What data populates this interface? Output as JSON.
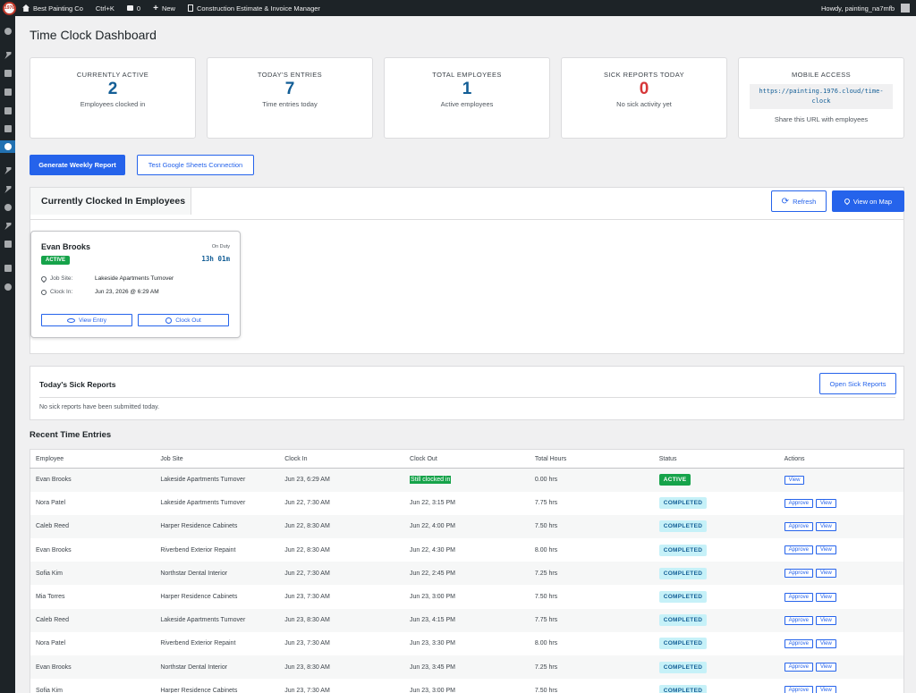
{
  "adminbar": {
    "logo_text": "1976",
    "site_name": "Best Painting Co",
    "shortcut": "Ctrl+K",
    "comments_count": "0",
    "new_label": "New",
    "plugin_name": "Construction Estimate & Invoice Manager",
    "howdy": "Howdy, painting_na7mfb"
  },
  "page": {
    "title": "Time Clock Dashboard"
  },
  "stats": {
    "active": {
      "label": "CURRENTLY ACTIVE",
      "value": "2",
      "sub": "Employees clocked in"
    },
    "entries": {
      "label": "TODAY'S ENTRIES",
      "value": "7",
      "sub": "Time entries today"
    },
    "employees": {
      "label": "TOTAL EMPLOYEES",
      "value": "1",
      "sub": "Active employees"
    },
    "sick": {
      "label": "SICK REPORTS TODAY",
      "value": "0",
      "sub": "No sick activity yet"
    },
    "mobile": {
      "label": "MOBILE ACCESS",
      "url": "https://painting.1976.cloud/time-clock",
      "note": "Share this URL with employees"
    }
  },
  "actions": {
    "weekly_report": "Generate Weekly Report",
    "test_sheets": "Test Google Sheets Connection"
  },
  "clocked_in": {
    "title": "Currently Clocked In Employees",
    "refresh": "Refresh",
    "view_map": "View on Map",
    "card": {
      "name": "Evan Brooks",
      "badge": "ACTIVE",
      "duty": "On Duty",
      "elapsed": "13h 01m",
      "job_site_label": "Job Site:",
      "job_site": "Lakeside Apartments Turnover",
      "clock_in_label": "Clock In:",
      "clock_in": "Jun 23, 2026 @ 6:29 AM",
      "view_entry": "View Entry",
      "clock_out": "Clock Out"
    }
  },
  "sick_reports": {
    "title": "Today's Sick Reports",
    "open_button": "Open Sick Reports",
    "empty": "No sick reports have been submitted today."
  },
  "recent": {
    "title": "Recent Time Entries",
    "columns": [
      "Employee",
      "Job Site",
      "Clock In",
      "Clock Out",
      "Total Hours",
      "Status",
      "Actions"
    ],
    "approve_label": "Approve",
    "view_label": "View",
    "rows": [
      {
        "employee": "Evan Brooks",
        "site": "Lakeside Apartments Turnover",
        "in": "Jun 23, 6:29 AM",
        "out": "Still clocked in",
        "hours": "0.00 hrs",
        "status": "ACTIVE"
      },
      {
        "employee": "Nora Patel",
        "site": "Lakeside Apartments Turnover",
        "in": "Jun 22, 7:30 AM",
        "out": "Jun 22, 3:15 PM",
        "hours": "7.75 hrs",
        "status": "COMPLETED"
      },
      {
        "employee": "Caleb Reed",
        "site": "Harper Residence Cabinets",
        "in": "Jun 22, 8:30 AM",
        "out": "Jun 22, 4:00 PM",
        "hours": "7.50 hrs",
        "status": "COMPLETED"
      },
      {
        "employee": "Evan Brooks",
        "site": "Riverbend Exterior Repaint",
        "in": "Jun 22, 8:30 AM",
        "out": "Jun 22, 4:30 PM",
        "hours": "8.00 hrs",
        "status": "COMPLETED"
      },
      {
        "employee": "Sofia Kim",
        "site": "Northstar Dental Interior",
        "in": "Jun 22, 7:30 AM",
        "out": "Jun 22, 2:45 PM",
        "hours": "7.25 hrs",
        "status": "COMPLETED"
      },
      {
        "employee": "Mia Torres",
        "site": "Harper Residence Cabinets",
        "in": "Jun 23, 7:30 AM",
        "out": "Jun 23, 3:00 PM",
        "hours": "7.50 hrs",
        "status": "COMPLETED"
      },
      {
        "employee": "Caleb Reed",
        "site": "Lakeside Apartments Turnover",
        "in": "Jun 23, 8:30 AM",
        "out": "Jun 23, 4:15 PM",
        "hours": "7.75 hrs",
        "status": "COMPLETED"
      },
      {
        "employee": "Nora Patel",
        "site": "Riverbend Exterior Repaint",
        "in": "Jun 23, 7:30 AM",
        "out": "Jun 23, 3:30 PM",
        "hours": "8.00 hrs",
        "status": "COMPLETED"
      },
      {
        "employee": "Evan Brooks",
        "site": "Northstar Dental Interior",
        "in": "Jun 23, 8:30 AM",
        "out": "Jun 23, 3:45 PM",
        "hours": "7.25 hrs",
        "status": "COMPLETED"
      },
      {
        "employee": "Sofia Kim",
        "site": "Harper Residence Cabinets",
        "in": "Jun 23, 7:30 AM",
        "out": "Jun 23, 3:00 PM",
        "hours": "7.50 hrs",
        "status": "COMPLETED"
      }
    ]
  }
}
